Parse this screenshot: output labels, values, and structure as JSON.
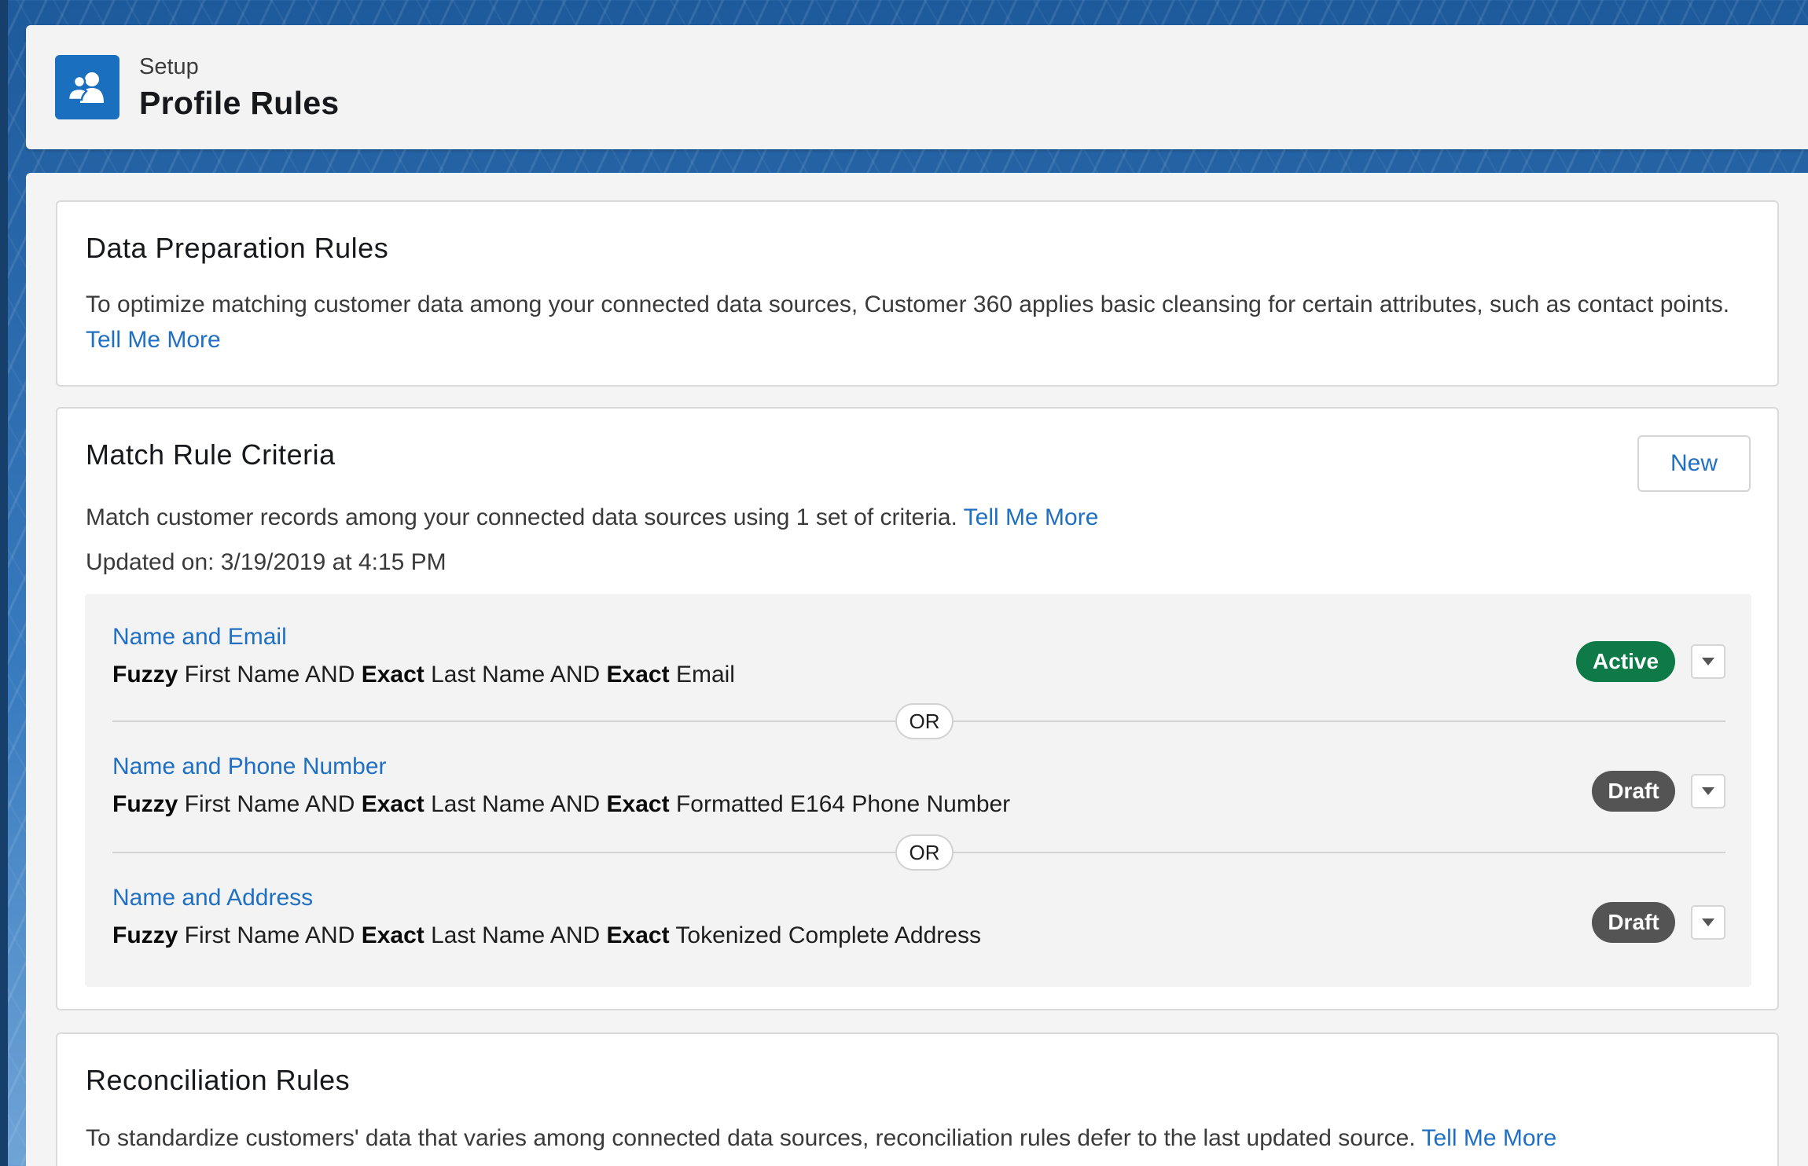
{
  "header": {
    "eyebrow": "Setup",
    "title": "Profile Rules",
    "icon": "user-group-icon"
  },
  "prep": {
    "title": "Data Preparation Rules",
    "text": "To optimize matching customer data among your connected data sources, Customer 360 applies basic cleansing for certain attributes, such as contact points. ",
    "link": "Tell Me More"
  },
  "match": {
    "title": "Match Rule Criteria",
    "new_label": "New",
    "text": "Match customer records among your connected data sources using 1 set of criteria. ",
    "link": "Tell Me More",
    "updated": "Updated on: 3/19/2019 at 4:15 PM",
    "or_label": "OR",
    "rules": [
      {
        "name": "Name and Email",
        "status": "Active",
        "desc": [
          {
            "b": "Fuzzy",
            "t": " First Name AND "
          },
          {
            "b": "Exact",
            "t": " Last Name AND "
          },
          {
            "b": "Exact",
            "t": " Email"
          }
        ]
      },
      {
        "name": "Name and Phone Number",
        "status": "Draft",
        "desc": [
          {
            "b": "Fuzzy",
            "t": " First Name AND "
          },
          {
            "b": "Exact",
            "t": " Last Name AND "
          },
          {
            "b": "Exact",
            "t": " Formatted E164 Phone Number"
          }
        ]
      },
      {
        "name": "Name and Address",
        "status": "Draft",
        "desc": [
          {
            "b": "Fuzzy",
            "t": " First Name AND "
          },
          {
            "b": "Exact",
            "t": " Last Name AND "
          },
          {
            "b": "Exact",
            "t": " Tokenized Complete Address"
          }
        ]
      }
    ]
  },
  "recon": {
    "title": "Reconciliation Rules",
    "text": "To standardize customers' data that varies among connected data sources, reconciliation rules defer to the last updated source. ",
    "link": "Tell Me More"
  },
  "colors": {
    "brand": "#1a6fbf",
    "link": "#1f6fc3",
    "active": "#0d7a47",
    "draft": "#545454"
  }
}
